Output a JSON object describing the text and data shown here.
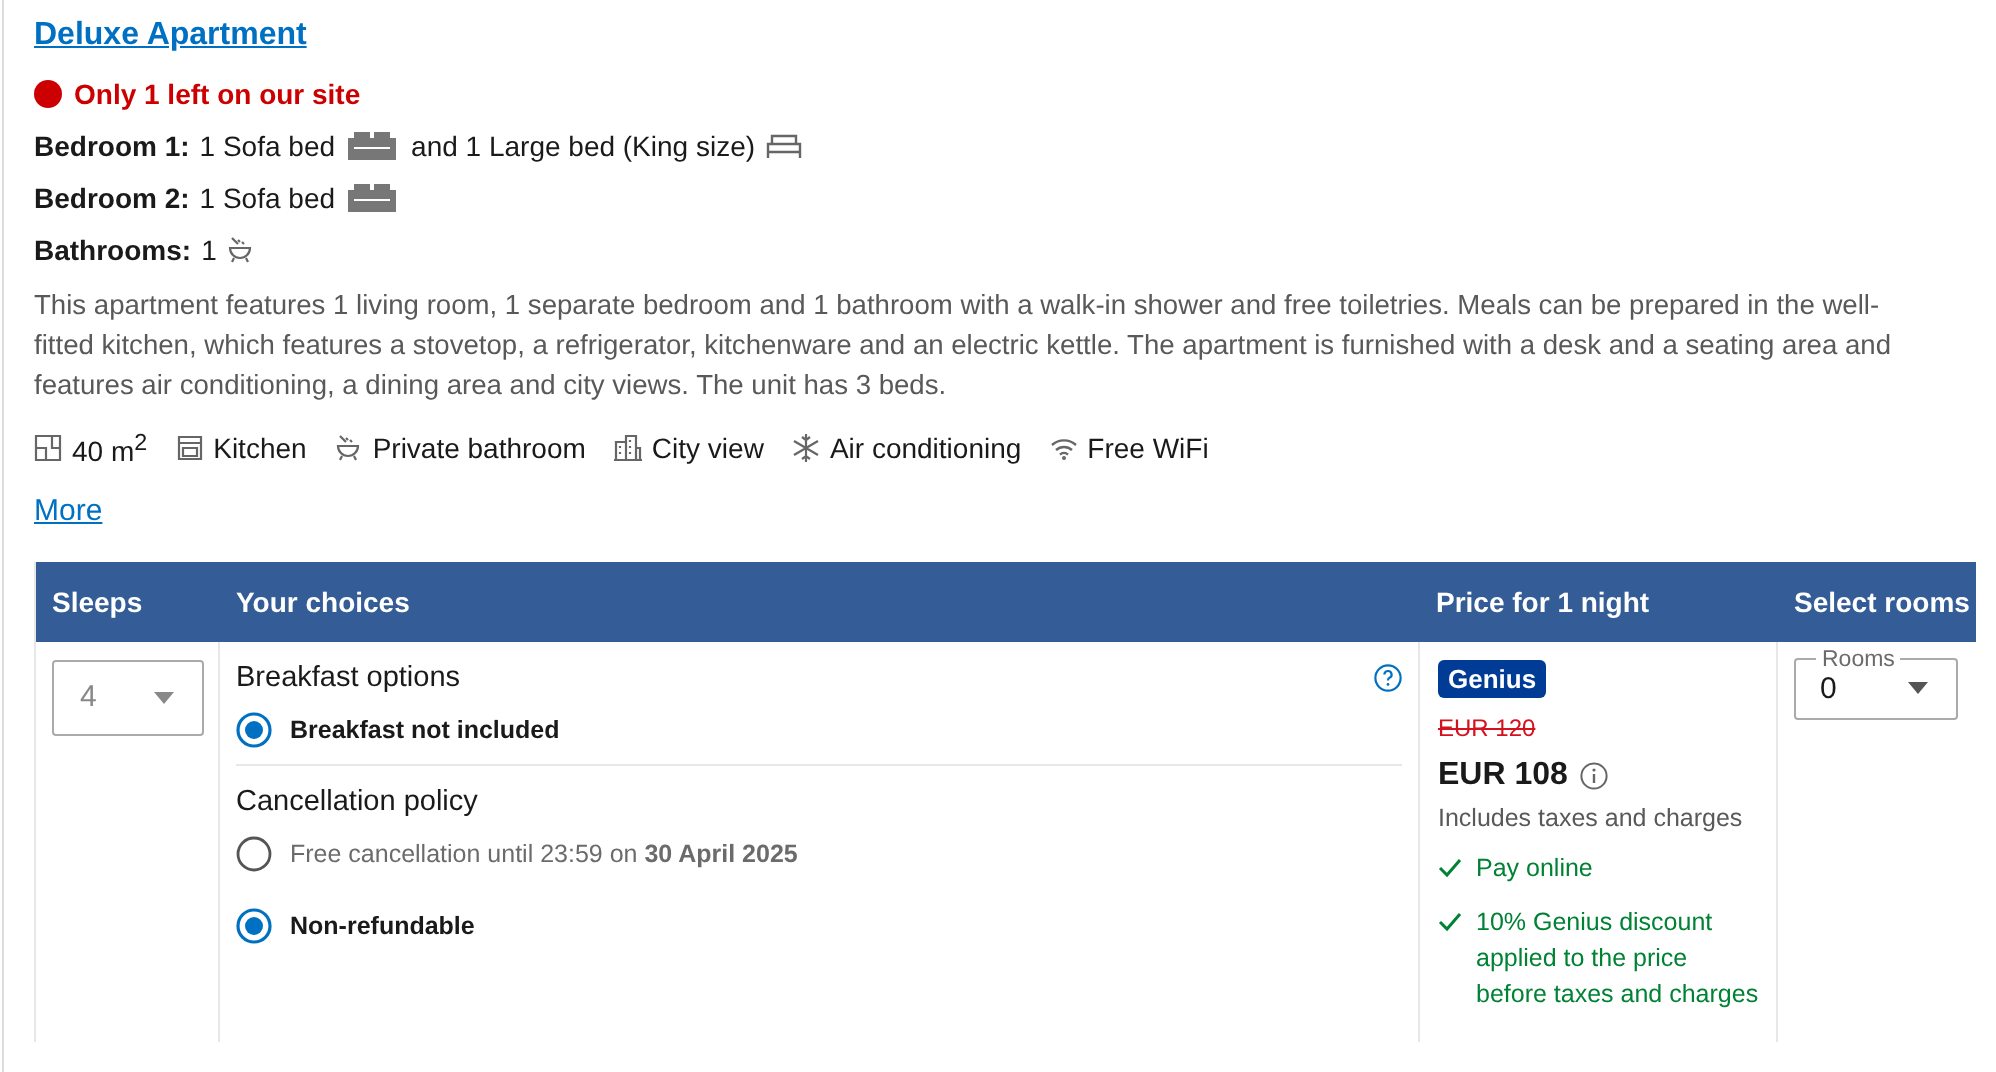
{
  "room_title": "Deluxe Apartment",
  "scarcity": "Only 1 left on our site",
  "rooms": [
    {
      "label": "Bedroom 1:",
      "items": [
        {
          "text": "1 Sofa bed",
          "kind": "sofa"
        },
        {
          "text": "and 1 Large bed (King size)",
          "kind": "bed"
        }
      ]
    },
    {
      "label": "Bedroom 2:",
      "items": [
        {
          "text": "1 Sofa bed",
          "kind": "sofa"
        }
      ]
    },
    {
      "label": "Bathrooms:",
      "items": [
        {
          "text": "1",
          "kind": "bath"
        }
      ]
    }
  ],
  "description": "This apartment features 1 living room, 1 separate bedroom and 1 bathroom with a walk-in shower and free toiletries. Meals can be prepared in the well-fitted kitchen, which features a stovetop, a refrigerator, kitchenware and an electric kettle. The apartment is furnished with a desk and a seating area and features air conditioning, a dining area and city views. The unit has 3 beds.",
  "facilities": [
    {
      "label": "40 m$^{2}$",
      "kind": "size"
    },
    {
      "label": "Kitchen",
      "kind": "kitchen"
    },
    {
      "label": "Private bathroom",
      "kind": "bath"
    },
    {
      "label": "City view",
      "kind": "city"
    },
    {
      "label": "Air conditioning",
      "kind": "snow"
    },
    {
      "label": "Free WiFi",
      "kind": "wifi"
    }
  ],
  "more_link": "More",
  "table": {
    "columns": [
      "Sleeps",
      "Your choices",
      "Price for 1 night",
      "Select rooms"
    ],
    "sleeps": {
      "value": "4"
    },
    "choice_groups": [
      {
        "title": "Breakfast options",
        "help": true,
        "options": [
          {
            "label": "Breakfast not included",
            "selected": true
          }
        ]
      },
      {
        "title": "Cancellation policy",
        "help": false,
        "options": [
          {
            "label": "Free cancellation until 23:59 on **30 April 2025**",
            "selected": false
          },
          {
            "label": "Non-refundable",
            "selected": true
          }
        ]
      }
    ],
    "price": {
      "badge": "Genius",
      "old_price": "EUR 120",
      "price": "EUR 108",
      "note": "Includes taxes and charges",
      "perks": [
        "Pay online",
        "10% Genius discount applied to the price before taxes and charges"
      ]
    },
    "rooms_select": {
      "label": "Rooms",
      "value": "0"
    }
  }
}
